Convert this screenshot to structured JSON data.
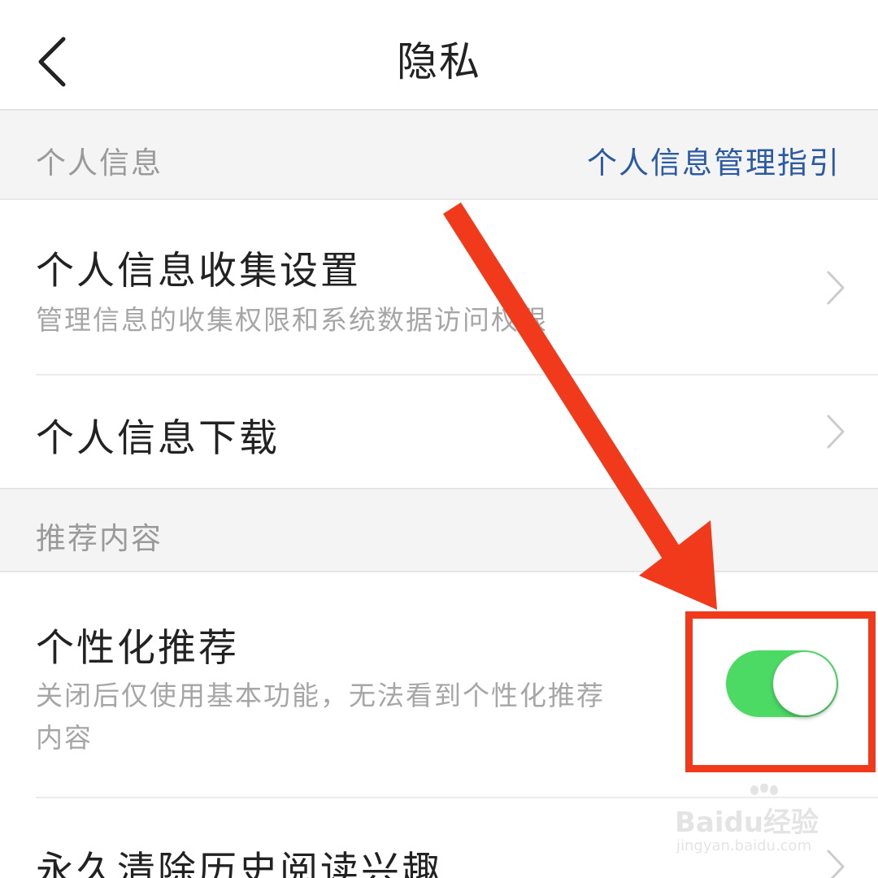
{
  "header": {
    "title": "隐私"
  },
  "sections": [
    {
      "title": "个人信息",
      "link": "个人信息管理指引"
    },
    {
      "title": "推荐内容"
    }
  ],
  "rows": [
    {
      "title": "个人信息收集设置",
      "description": "管理信息的收集权限和系统数据访问权限"
    },
    {
      "title": "个人信息下载"
    },
    {
      "title": "个性化推荐",
      "description_line1": "关闭后仅使用基本功能，无法看到个性化推荐",
      "description_line2": "内容",
      "toggle_on": true
    },
    {
      "title": "永久清除历史阅读兴趣"
    }
  ],
  "watermark": {
    "brand": "Baidu经验",
    "url": "jingyan.baidu.com"
  },
  "colors": {
    "toggle_on": "#4cd964",
    "link": "#2b5aa3",
    "annotation": "#f13a1c"
  },
  "icons": [
    "back-arrow-icon",
    "chevron-right-icon",
    "baidu-paw-icon"
  ]
}
